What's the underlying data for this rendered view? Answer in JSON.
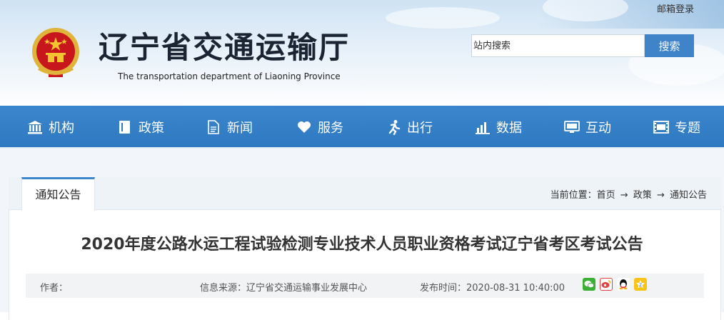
{
  "header": {
    "mail_login": "邮箱登录",
    "site_title": "辽宁省交通运输厅",
    "site_subtitle": "The transportation department of Liaoning Province",
    "search_placeholder": "站内搜索",
    "search_button": "搜索"
  },
  "nav": {
    "items": [
      {
        "label": "机构",
        "icon": "institution-icon"
      },
      {
        "label": "政策",
        "icon": "book-icon"
      },
      {
        "label": "新闻",
        "icon": "document-icon"
      },
      {
        "label": "服务",
        "icon": "heart-icon"
      },
      {
        "label": "出行",
        "icon": "runner-icon"
      },
      {
        "label": "数据",
        "icon": "bar-chart-icon"
      },
      {
        "label": "互动",
        "icon": "monitor-icon"
      },
      {
        "label": "专题",
        "icon": "film-icon"
      }
    ]
  },
  "section": {
    "tab": "通知公告",
    "breadcrumb_prefix": "当前位置：",
    "breadcrumb": [
      "首页",
      "政策",
      "通知公告"
    ],
    "arrow": "→"
  },
  "article": {
    "title": "2020年度公路水运工程试验检测专业技术人员职业资格考试辽宁省考区考试公告",
    "author": "作者：",
    "source": "信息来源：辽宁省交通运输事业发展中心",
    "published": "发布时间：2020-08-31 10:40:00",
    "share_icons": [
      "wechat-icon",
      "weibo-icon",
      "qq-icon",
      "qzone-icon"
    ]
  },
  "colors": {
    "nav_blue": "#2e79c1",
    "search_button": "#3f83c8",
    "emblem_red": "#c8161d",
    "emblem_gold": "#f4c430"
  }
}
